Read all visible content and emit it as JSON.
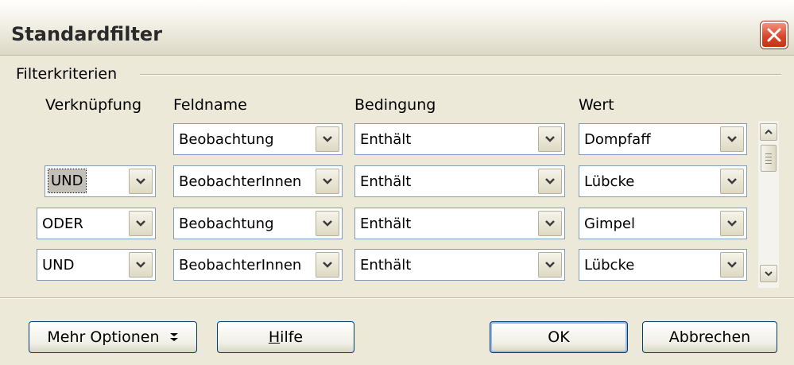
{
  "dialog": {
    "title": "Standardfilter"
  },
  "group": {
    "label": "Filterkriterien"
  },
  "headers": {
    "connector": "Verknüpfung",
    "field": "Feldname",
    "condition": "Bedingung",
    "value": "Wert"
  },
  "rows": [
    {
      "connector": "",
      "field": "Beobachtung",
      "condition": "Enthält",
      "value": "Dompfaff"
    },
    {
      "connector": "UND",
      "field": "BeobachterInnen",
      "condition": "Enthält",
      "value": "Lübcke"
    },
    {
      "connector": "ODER",
      "field": "Beobachtung",
      "condition": "Enthält",
      "value": "Gimpel"
    },
    {
      "connector": "UND",
      "field": "BeobachterInnen",
      "condition": "Enthält",
      "value": "Lübcke"
    }
  ],
  "buttons": {
    "more_options": "Mehr Optionen",
    "more_options_icon": "double-chevron-down-icon",
    "help_first": "H",
    "help_rest": "ilfe",
    "ok": "OK",
    "cancel": "Abbrechen"
  },
  "colors": {
    "close_button": "#d9472b",
    "field_border": "#7f9db9",
    "button_border": "#003c74",
    "dialog_bg": "#ece9d8"
  }
}
